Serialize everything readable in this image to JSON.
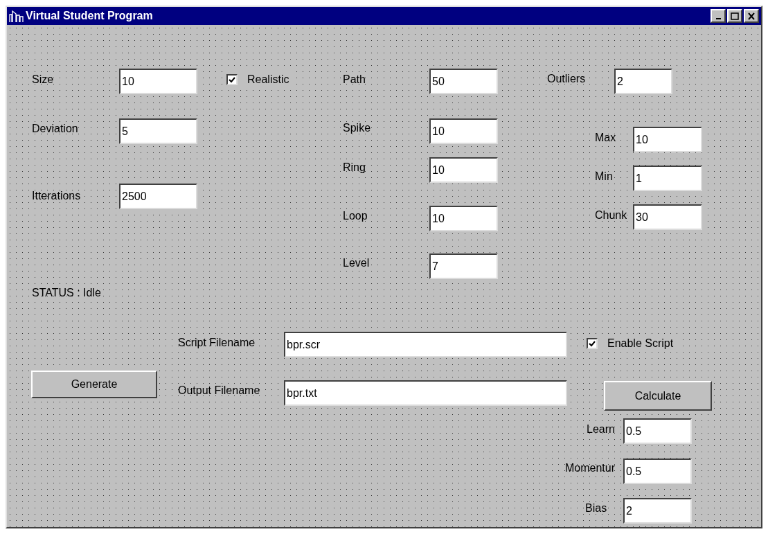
{
  "window": {
    "title": "Virtual Student Program"
  },
  "fields": [
    {
      "label": "Size",
      "value": "10"
    },
    {
      "label": "Deviation",
      "value": "5"
    },
    {
      "label": "Itterations",
      "value": "2500"
    },
    {
      "label": "Path",
      "value": "50"
    },
    {
      "label": "Spike",
      "value": "10"
    },
    {
      "label": "Ring",
      "value": "10"
    },
    {
      "label": "Loop",
      "value": "10"
    },
    {
      "label": "Level",
      "value": "7"
    },
    {
      "label": "Outliers",
      "value": "2"
    },
    {
      "label": "Max",
      "value": "10"
    },
    {
      "label": "Min",
      "value": "1"
    },
    {
      "label": "Chunk",
      "value": "30"
    },
    {
      "label": "Script Filename",
      "value": "bpr.scr"
    },
    {
      "label": "Output Filename",
      "value": "bpr.txt"
    },
    {
      "label": "Learn",
      "value": "0.5"
    },
    {
      "label": "Momentur",
      "value": "0.5"
    },
    {
      "label": "Bias",
      "value": "2"
    }
  ],
  "checkboxes": [
    {
      "label": "Realistic",
      "checked": true
    },
    {
      "label": "Enable Script",
      "checked": true
    }
  ],
  "status": "STATUS : Idle",
  "buttons": [
    "Generate",
    "Calculate"
  ]
}
